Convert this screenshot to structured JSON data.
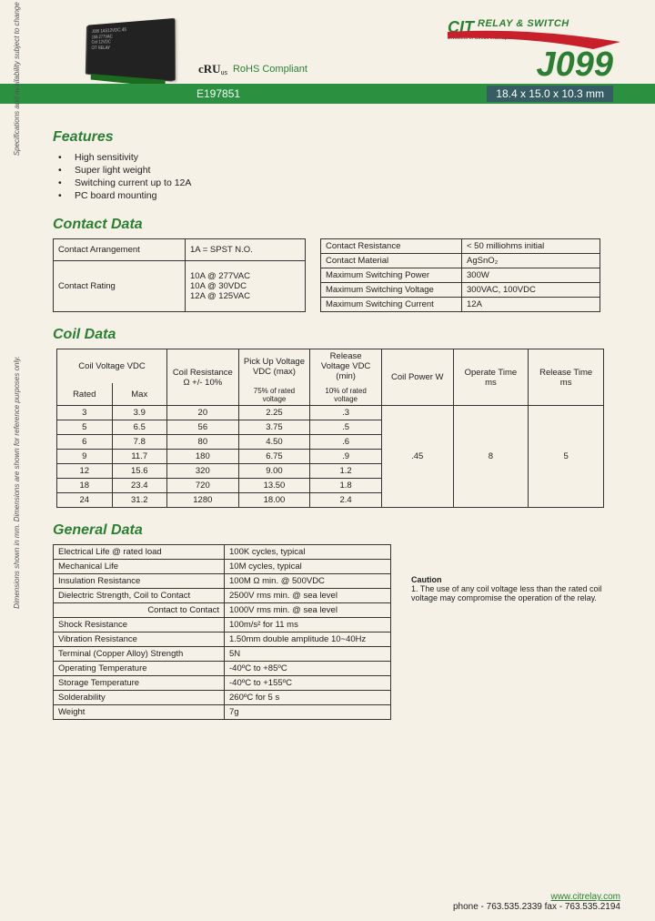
{
  "company": {
    "name_main": "CIT",
    "name_sub": "RELAY & SWITCH",
    "tagline": "Divisions of Circuit Interruption Technology, Inc."
  },
  "part_number": "J099",
  "header": {
    "rohs": "RoHS Compliant",
    "file_number": "E197851",
    "dimensions": "18.4 x 15.0 x 10.3 mm"
  },
  "features": {
    "title": "Features",
    "items": [
      "High sensitivity",
      "Super light weight",
      "Switching current up to 12A",
      "PC board mounting"
    ]
  },
  "contact_data": {
    "title": "Contact Data",
    "left": [
      {
        "label": "Contact Arrangement",
        "value": "1A = SPST N.O."
      },
      {
        "label": "Contact Rating",
        "value": "10A @ 277VAC\n10A @ 30VDC\n12A @ 125VAC"
      }
    ],
    "right": [
      {
        "label": "Contact Resistance",
        "value": "< 50 milliohms initial"
      },
      {
        "label": "Contact Material",
        "value": "AgSnO₂"
      },
      {
        "label": "Maximum Switching Power",
        "value": "300W"
      },
      {
        "label": "Maximum Switching Voltage",
        "value": "300VAC, 100VDC"
      },
      {
        "label": "Maximum Switching Current",
        "value": "12A"
      }
    ]
  },
  "coil_data": {
    "title": "Coil Data",
    "headers": {
      "voltage": "Coil Voltage VDC",
      "rated": "Rated",
      "max": "Max",
      "resistance": "Coil Resistance Ω +/- 10%",
      "pickup": "Pick Up Voltage VDC (max)",
      "pickup_sub": "75% of rated voltage",
      "release": "Release Voltage VDC (min)",
      "release_sub": "10% of rated voltage",
      "power": "Coil Power W",
      "operate": "Operate Time ms",
      "releaset": "Release Time ms"
    },
    "rows": [
      {
        "rated": "3",
        "max": "3.9",
        "res": "20",
        "pu": "2.25",
        "rel": ".3"
      },
      {
        "rated": "5",
        "max": "6.5",
        "res": "56",
        "pu": "3.75",
        "rel": ".5"
      },
      {
        "rated": "6",
        "max": "7.8",
        "res": "80",
        "pu": "4.50",
        "rel": ".6"
      },
      {
        "rated": "9",
        "max": "11.7",
        "res": "180",
        "pu": "6.75",
        "rel": ".9"
      },
      {
        "rated": "12",
        "max": "15.6",
        "res": "320",
        "pu": "9.00",
        "rel": "1.2"
      },
      {
        "rated": "18",
        "max": "23.4",
        "res": "720",
        "pu": "13.50",
        "rel": "1.8"
      },
      {
        "rated": "24",
        "max": "31.2",
        "res": "1280",
        "pu": "18.00",
        "rel": "2.4"
      }
    ],
    "shared": {
      "power": ".45",
      "operate": "8",
      "release": "5"
    }
  },
  "general_data": {
    "title": "General Data",
    "rows": [
      {
        "label": "Electrical Life @ rated load",
        "value": "100K cycles, typical"
      },
      {
        "label": "Mechanical Life",
        "value": "10M cycles, typical"
      },
      {
        "label": "Insulation Resistance",
        "value": "100M Ω min. @ 500VDC"
      },
      {
        "label": "Dielectric Strength, Coil to Contact",
        "value": "2500V rms min. @ sea level"
      },
      {
        "label": "Contact to Contact",
        "value": "1000V rms min. @ sea level",
        "indent": true
      },
      {
        "label": "Shock Resistance",
        "value": "100m/s² for 11 ms"
      },
      {
        "label": "Vibration Resistance",
        "value": "1.50mm double amplitude 10~40Hz"
      },
      {
        "label": "Terminal (Copper Alloy) Strength",
        "value": "5N"
      },
      {
        "label": "Operating Temperature",
        "value": "-40ºC to +85ºC"
      },
      {
        "label": "Storage Temperature",
        "value": "-40ºC to +155ºC"
      },
      {
        "label": "Solderability",
        "value": "260ºC for 5 s"
      },
      {
        "label": "Weight",
        "value": "7g"
      }
    ]
  },
  "caution": {
    "title": "Caution",
    "text": "1. The use of any coil voltage less than the rated coil voltage may compromise the operation of the relay."
  },
  "footer": {
    "url": "www.citrelay.com",
    "contact": "phone - 763.535.2339    fax - 763.535.2194"
  },
  "side_notes": {
    "note1": "Specifications and availability subject to change without notice.",
    "note2": "Dimensions shown in mm. Dimensions are shown for reference purposes only."
  },
  "chart_data": {
    "type": "table",
    "title": "Coil Data",
    "columns": [
      "Rated VDC",
      "Max VDC",
      "Coil Resistance Ω ±10%",
      "Pick Up VDC max",
      "Release VDC min",
      "Coil Power W",
      "Operate Time ms",
      "Release Time ms"
    ],
    "rows": [
      [
        3,
        3.9,
        20,
        2.25,
        0.3,
        0.45,
        8,
        5
      ],
      [
        5,
        6.5,
        56,
        3.75,
        0.5,
        0.45,
        8,
        5
      ],
      [
        6,
        7.8,
        80,
        4.5,
        0.6,
        0.45,
        8,
        5
      ],
      [
        9,
        11.7,
        180,
        6.75,
        0.9,
        0.45,
        8,
        5
      ],
      [
        12,
        15.6,
        320,
        9.0,
        1.2,
        0.45,
        8,
        5
      ],
      [
        18,
        23.4,
        720,
        13.5,
        1.8,
        0.45,
        8,
        5
      ],
      [
        24,
        31.2,
        1280,
        18.0,
        2.4,
        0.45,
        8,
        5
      ]
    ]
  }
}
